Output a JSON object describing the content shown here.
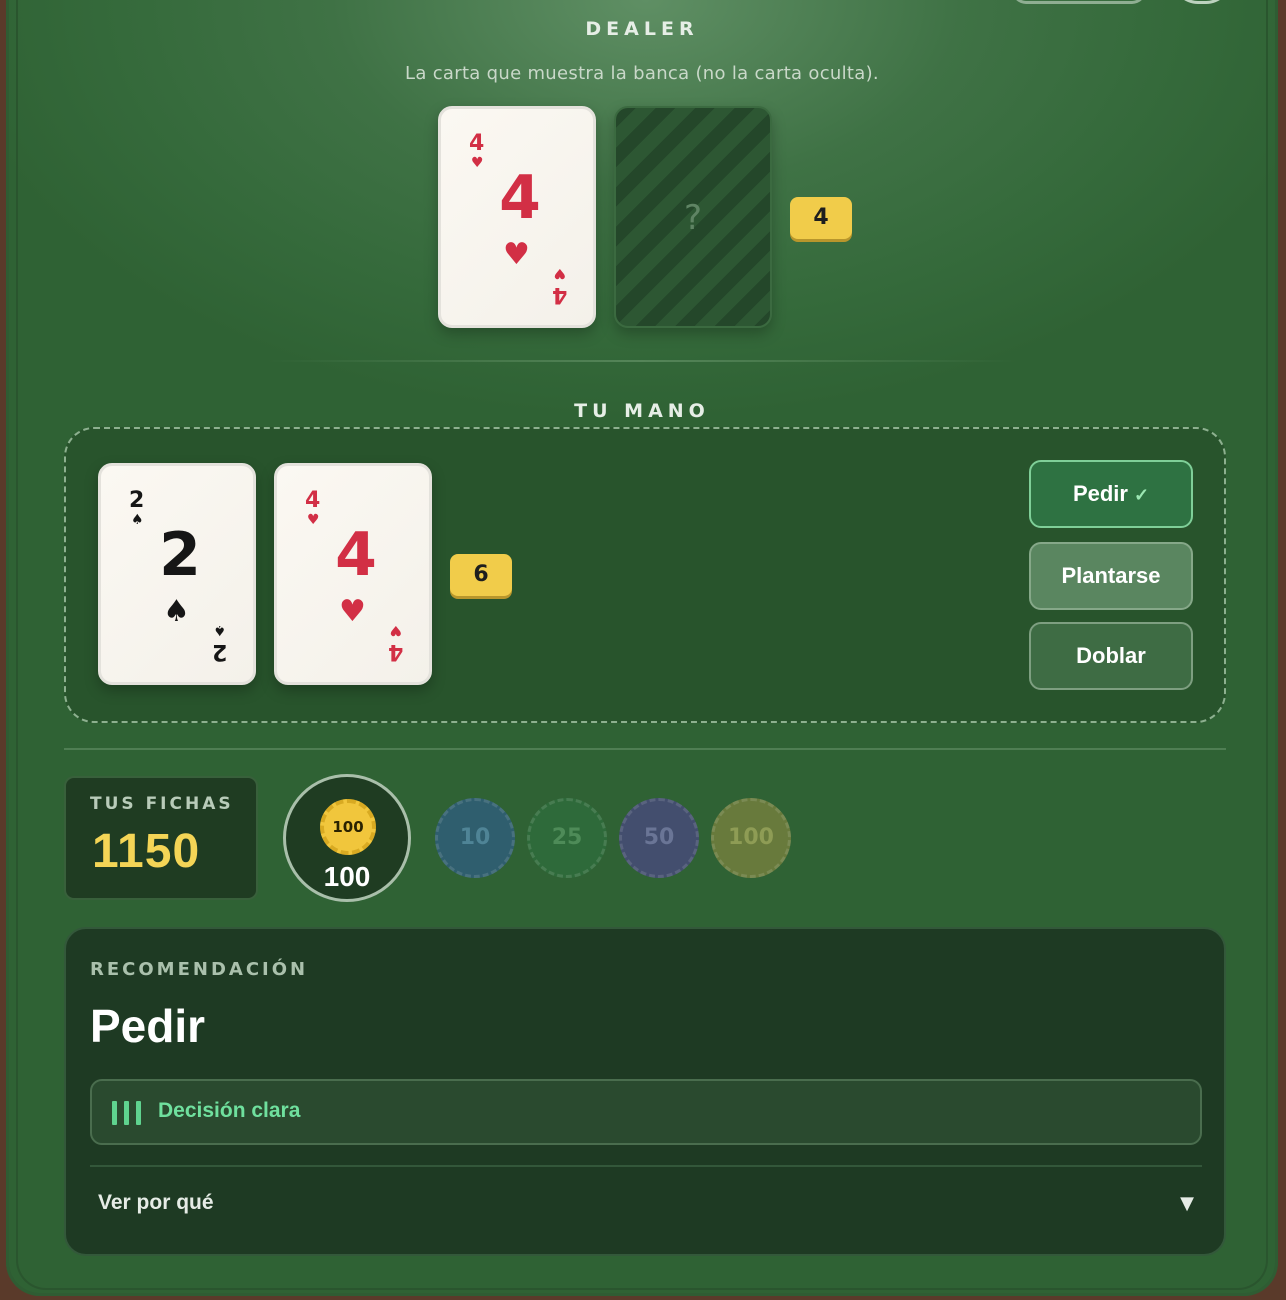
{
  "dealer": {
    "title": "DEALER",
    "subtitle": "La carta que muestra la banca (no la carta oculta).",
    "up_card": {
      "rank": "4",
      "suit": "♥"
    },
    "hidden_card_symbol": "?",
    "total": "4"
  },
  "player": {
    "title": "TU MANO",
    "cards": [
      {
        "rank": "2",
        "suit": "♠"
      },
      {
        "rank": "4",
        "suit": "♥"
      }
    ],
    "total": "6"
  },
  "actions": {
    "hit": "Pedir",
    "hit_mark": "✓",
    "stand": "Plantarse",
    "double": "Doblar"
  },
  "chips": {
    "label": "TUS FICHAS",
    "balance": "1150",
    "bet_chip": "100",
    "bet_amount": "100",
    "denominations": [
      "10",
      "25",
      "50",
      "100"
    ]
  },
  "recommendation": {
    "label": "RECOMENDACIÓN",
    "action": "Pedir",
    "confidence": "Decisión clara",
    "why": "Ver por qué",
    "arrow": "▼"
  },
  "colors": {
    "felt": "#3f7245",
    "badge": "#f1cc4a",
    "balance": "#f4d556",
    "confidence": "#6fe09e",
    "red_suit": "#d22f45"
  }
}
